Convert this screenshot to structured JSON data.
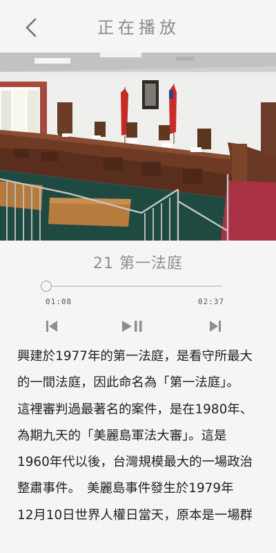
{
  "header": {
    "title": "正在播放",
    "back_icon": "back-arrow-icon"
  },
  "player": {
    "track_title": "21 第一法庭",
    "current_time": "01:08",
    "total_time": "02:37",
    "progress": 0.0,
    "controls": {
      "previous_icon": "skip-previous-icon",
      "play_pause_icon": "play-pause-icon",
      "next_icon": "skip-next-icon"
    }
  },
  "description": "興建於1977年的第一法庭，是看守所最大\n的一間法庭，因此命名為「第一法庭」。\n這裡審判過最著名的案件，是在1980年、\n為期九天的「美麗島軍法大審」。這是\n1960年代以後，台灣規模最大的一場政治\n整肅事件。　美麗島事件發生於1979年\n12月10日世界人權日當天，原本是一場群",
  "colors": {
    "background": "#f5f5f5",
    "title_gray": "#8a8a8a",
    "icon_gray": "#8e8e8e",
    "text": "#222222"
  }
}
